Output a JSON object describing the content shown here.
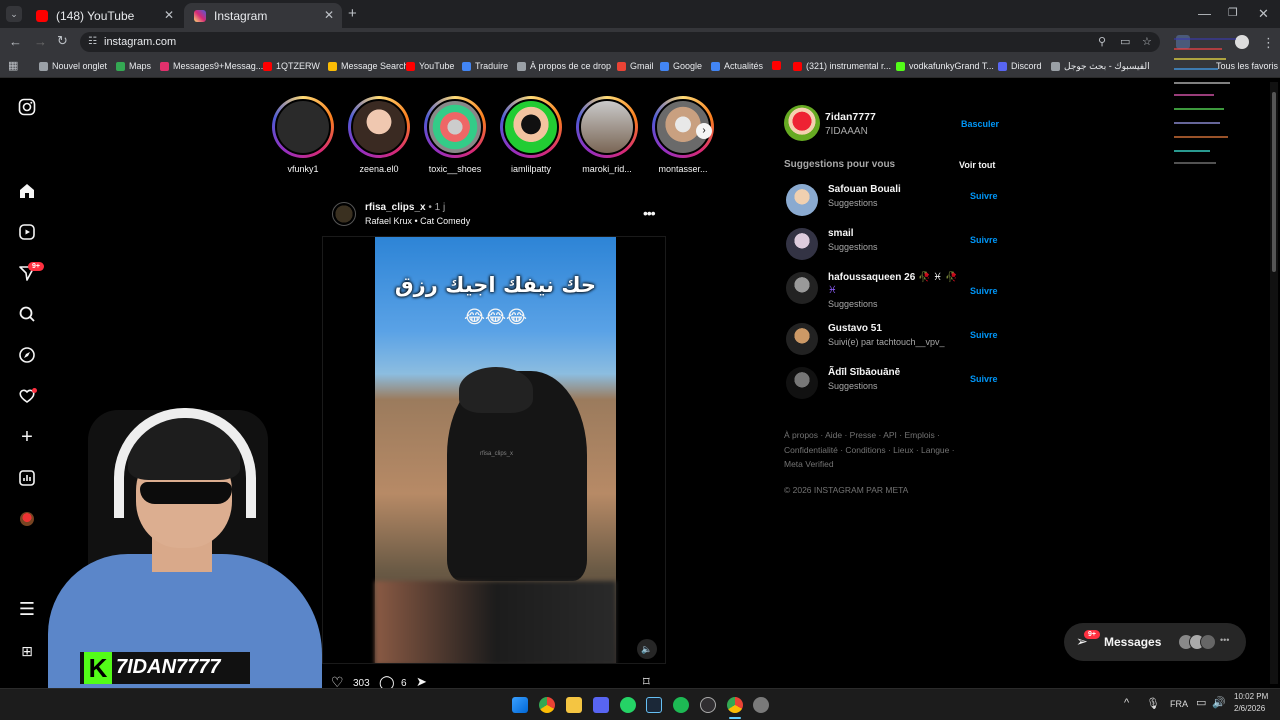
{
  "browser": {
    "tabs": [
      {
        "label": "(148) YouTube",
        "active": false
      },
      {
        "label": "Instagram",
        "active": true
      }
    ],
    "new_tab": "+",
    "url": "instagram.com",
    "bookmarks": [
      {
        "label": "Nouvel onglet",
        "color": "#9aa0a6"
      },
      {
        "label": "Maps",
        "color": "#34a853"
      },
      {
        "label": "Messages9+Messag...",
        "color": "#e1306c"
      },
      {
        "label": "1QTZERW",
        "color": "#ff0000"
      },
      {
        "label": "Message Search",
        "color": "#fbbc05"
      },
      {
        "label": "YouTube",
        "color": "#ff0000"
      },
      {
        "label": "Traduire",
        "color": "#4285f4"
      },
      {
        "label": "À propos de ce drop",
        "color": "#9aa0a6"
      },
      {
        "label": "Gmail",
        "color": "#ea4335"
      },
      {
        "label": "Google",
        "color": "#4285f4"
      },
      {
        "label": "Actualités",
        "color": "#4285f4"
      },
      {
        "label": "",
        "color": "#ff0000"
      },
      {
        "label": "(321) instrumental r...",
        "color": "#ff0000"
      },
      {
        "label": "vodkafunkyGrand T...",
        "color": "#53fc18"
      },
      {
        "label": "Discord",
        "color": "#5865f2"
      },
      {
        "label": "الفيسبوك - بحث جوجل",
        "color": "#9aa0a6"
      }
    ],
    "all_bookmarks": "Tous les favoris"
  },
  "stories": [
    {
      "name": "vfunky1"
    },
    {
      "name": "zeena.el0"
    },
    {
      "name": "toxic__shoes"
    },
    {
      "name": "iamlilpatty"
    },
    {
      "name": "maroki_rid..."
    },
    {
      "name": "montasser..."
    }
  ],
  "post": {
    "username": "rfisa_clips_x",
    "time": "1 j",
    "audio": "Rafael Krux • Cat Comedy",
    "caption_line1": "حك نيفك اجيك رزق",
    "caption_line2": "😂😂😂",
    "watermark": "rfisa_clips_x",
    "likes": "303",
    "comments": "6"
  },
  "rail": {
    "notifications_badge": "9+"
  },
  "profile": {
    "username": "7idan7777",
    "name": "7IDAAAN",
    "switch": "Basculer"
  },
  "suggestions": {
    "title": "Suggestions pour vous",
    "see_all": "Voir tout",
    "items": [
      {
        "name": "Safouan Bouali",
        "sub": "Suggestions",
        "action": "Suivre"
      },
      {
        "name": "smail",
        "sub": "Suggestions",
        "action": "Suivre"
      },
      {
        "name": "hafoussaqueen 26 🥀 ♓ 🥀",
        "name2": "♓",
        "sub": "Suggestions",
        "action": "Suivre"
      },
      {
        "name": "Gustavo 51",
        "sub": "Suivi(e) par tachtouch__vpv_",
        "action": "Suivre"
      },
      {
        "name": "Ãdīl Sībāouānē",
        "sub": "Suggestions",
        "action": "Suivre"
      }
    ]
  },
  "footer": {
    "line1": "À propos · Aide · Presse · API · Emplois ·",
    "line2": "Confidentialité · Conditions · Lieux · Langue ·",
    "line3": "Meta Verified",
    "copyright": "© 2026 INSTAGRAM PAR META"
  },
  "messages": {
    "label": "Messages",
    "badge": "9+"
  },
  "streamer": {
    "tag": "7IDAN7777",
    "logo": "K"
  },
  "taskbar": {
    "language": "FRA",
    "time": "10:02 PM",
    "date": "2/6/2026"
  }
}
